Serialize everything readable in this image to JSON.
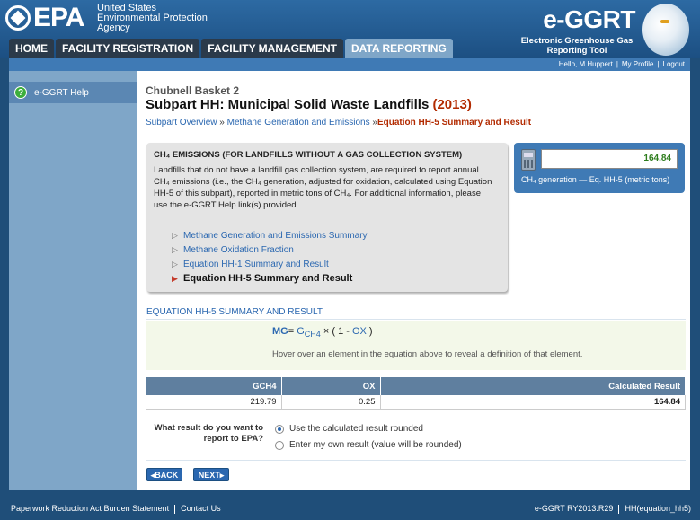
{
  "header": {
    "epa_logo_text": "EPA",
    "agency_line1": "United States",
    "agency_line2": "Environmental Protection",
    "agency_line3": "Agency",
    "brand_title": "e-GGRT",
    "brand_sub1": "Electronic Greenhouse Gas",
    "brand_sub2": "Reporting Tool"
  },
  "nav": {
    "tabs": [
      {
        "label": "HOME"
      },
      {
        "label": "FACILITY REGISTRATION"
      },
      {
        "label": "FACILITY MANAGEMENT"
      },
      {
        "label": "DATA REPORTING"
      }
    ],
    "active_tab": "DATA REPORTING"
  },
  "userbar": {
    "greeting": "Hello, M Huppert",
    "my_profile": "My Profile",
    "logout": "Logout"
  },
  "sidebar": {
    "help_label": "e-GGRT Help",
    "help_icon": "question-icon"
  },
  "main": {
    "facility_name": "Chubnell Basket 2",
    "page_title": "Subpart HH: Municipal Solid Waste Landfills",
    "year": "(2013)",
    "breadcrumb": {
      "item1": "Subpart Overview",
      "sep": "»",
      "item2": "Methane Generation and Emissions",
      "current": "Equation HH-5 Summary and Result"
    },
    "info": {
      "title": "CH₄ EMISSIONS (FOR LANDFILLS WITHOUT A GAS COLLECTION SYSTEM)",
      "text": "Landfills that do not have a landfill gas collection system, are required to report annual CH₄ emissions (i.e., the CH₄ generation, adjusted for oxidation, calculated using Equation HH-5 of this subpart), reported in metric tons of CH₄. For additional information, please use the e-GGRT Help link(s) provided.",
      "links": [
        {
          "label": "Methane Generation and Emissions Summary"
        },
        {
          "label": "Methane Oxidation Fraction"
        },
        {
          "label": "Equation HH-1 Summary and Result"
        },
        {
          "label": "Equation HH-5 Summary and Result"
        }
      ]
    },
    "result_card": {
      "value": "164.84",
      "label": "CH₄ generation — Eq. HH-5 (metric tons)"
    },
    "equation_section": {
      "heading": "EQUATION HH-5 SUMMARY AND RESULT",
      "lhs": "MG",
      "eq": "=",
      "gch4": "G",
      "gch4_sub": "CH4",
      "times": " × ( 1 - ",
      "ox": "OX",
      "close": " )",
      "hint": "Hover over an element in the equation above to reveal a definition of that element."
    },
    "table": {
      "headers": [
        "GCH4",
        "OX",
        "Calculated Result"
      ],
      "row": [
        "219.79",
        "0.25",
        "164.84"
      ]
    },
    "report": {
      "question": "What result do you want to report to EPA?",
      "option1": "Use the calculated result rounded",
      "option2": "Enter my own result (value will be rounded)",
      "selected": "option1"
    },
    "buttons": {
      "back": "◂BACK",
      "next": "NEXT▸"
    }
  },
  "footer": {
    "left1": "Paperwork Reduction Act Burden Statement",
    "left2": "Contact Us",
    "right1": "e-GGRT RY2013.R29",
    "right2": "HH(equation_hh5)"
  },
  "colors": {
    "header_blue": "#1f4e79",
    "sidebar_blue": "#7fa6c8",
    "link_blue": "#2a67b0",
    "accent_red": "#b22a00",
    "result_green": "#2e7d1d"
  }
}
